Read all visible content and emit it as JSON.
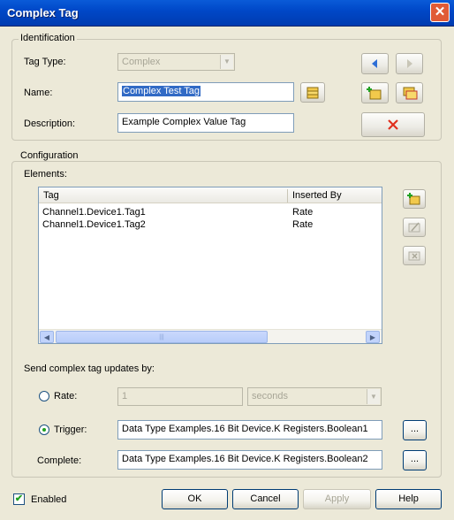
{
  "window": {
    "title": "Complex Tag"
  },
  "identification": {
    "legend": "Identification",
    "tag_type_label": "Tag Type:",
    "tag_type_value": "Complex",
    "name_label": "Name:",
    "name_value": "Complex Test Tag",
    "description_label": "Description:",
    "description_value": "Example Complex Value Tag"
  },
  "configuration": {
    "legend": "Configuration",
    "elements_label": "Elements:",
    "columns": [
      "Tag",
      "Inserted By"
    ],
    "rows": [
      {
        "tag": "Channel1.Device1.Tag1",
        "inserted_by": "Rate"
      },
      {
        "tag": "Channel1.Device1.Tag2",
        "inserted_by": "Rate"
      }
    ],
    "send_label": "Send complex tag updates by:",
    "rate_label": "Rate:",
    "rate_value": "1",
    "rate_unit": "seconds",
    "trigger_label": "Trigger:",
    "trigger_value": "Data Type Examples.16 Bit Device.K Registers.Boolean1",
    "complete_label": "Complete:",
    "complete_value": "Data Type Examples.16 Bit Device.K Registers.Boolean2",
    "browse_label": "...",
    "selected_mode": "Trigger"
  },
  "footer": {
    "enabled_label": "Enabled",
    "enabled_checked": true,
    "ok": "OK",
    "cancel": "Cancel",
    "apply": "Apply",
    "help": "Help"
  },
  "colors": {
    "titlebar": "#0054e3",
    "accent_blue": "#2f6fd6",
    "delete_red": "#e0301e"
  }
}
